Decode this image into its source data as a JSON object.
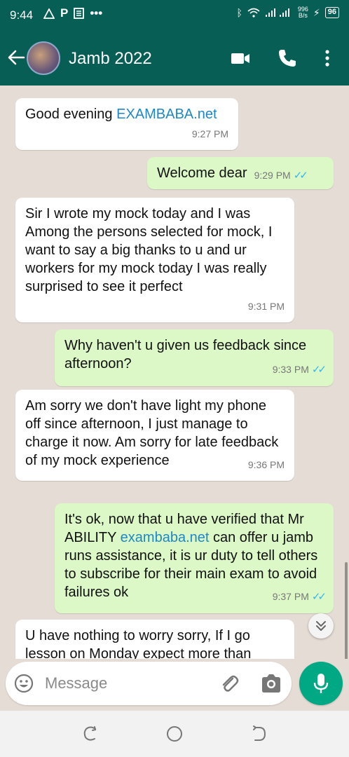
{
  "status_bar": {
    "time": "9:44",
    "left_icons": [
      "warning-triangle-icon",
      "P",
      "news-icon",
      "•••"
    ],
    "net_speed_value": "996",
    "net_speed_unit": "B/s",
    "battery": "96"
  },
  "header": {
    "title": "Jamb 2022",
    "icons": [
      "back-arrow-icon",
      "video-call-icon",
      "voice-call-icon",
      "more-options-icon"
    ]
  },
  "messages": [
    {
      "dir": "in",
      "parts": [
        {
          "text": "Good evening "
        },
        {
          "text": "EXAMBABA.net",
          "link": true
        }
      ],
      "time": "9:27 PM"
    },
    {
      "dir": "out",
      "parts": [
        {
          "text": "Welcome dear"
        }
      ],
      "time": "9:29 PM",
      "read": true
    },
    {
      "dir": "in",
      "parts": [
        {
          "text": "Sir I wrote my mock today and I was Among the persons selected for mock, I want to say a big thanks to u and ur workers for my mock today I was really surprised to see it perfect"
        }
      ],
      "time": "9:31 PM"
    },
    {
      "dir": "out",
      "parts": [
        {
          "text": "Why haven't u given us feedback since afternoon?"
        }
      ],
      "time": "9:33 PM",
      "read": true
    },
    {
      "dir": "in",
      "parts": [
        {
          "text": "Am sorry we don't have light my phone off since afternoon, I just manage to charge it now. Am sorry for late feedback of my mock experience"
        }
      ],
      "time": "9:36 PM"
    },
    {
      "dir": "out",
      "parts": [
        {
          "text": "It's ok, now that u have verified that Mr ABILITY "
        },
        {
          "text": "exambaba.net",
          "link": true
        },
        {
          "text": " can offer u jamb runs assistance, it is ur duty to tell others to subscribe for their main exam to avoid failures ok"
        }
      ],
      "time": "9:37 PM",
      "read": true
    },
    {
      "dir": "in",
      "parts": [
        {
          "text": "U have nothing to worry sorry, If I go lesson on Monday expect more than"
        }
      ],
      "time": ""
    }
  ],
  "composer": {
    "placeholder": "Message",
    "icons": [
      "emoji-icon",
      "attach-icon",
      "camera-icon",
      "mic-icon"
    ]
  },
  "colors": {
    "header": "#075e54",
    "incoming_bubble": "#ffffff",
    "outgoing_bubble": "#dcf8c6",
    "link": "#1e88c7",
    "read_ticks": "#34b7f1",
    "mic_button": "#00a884"
  }
}
